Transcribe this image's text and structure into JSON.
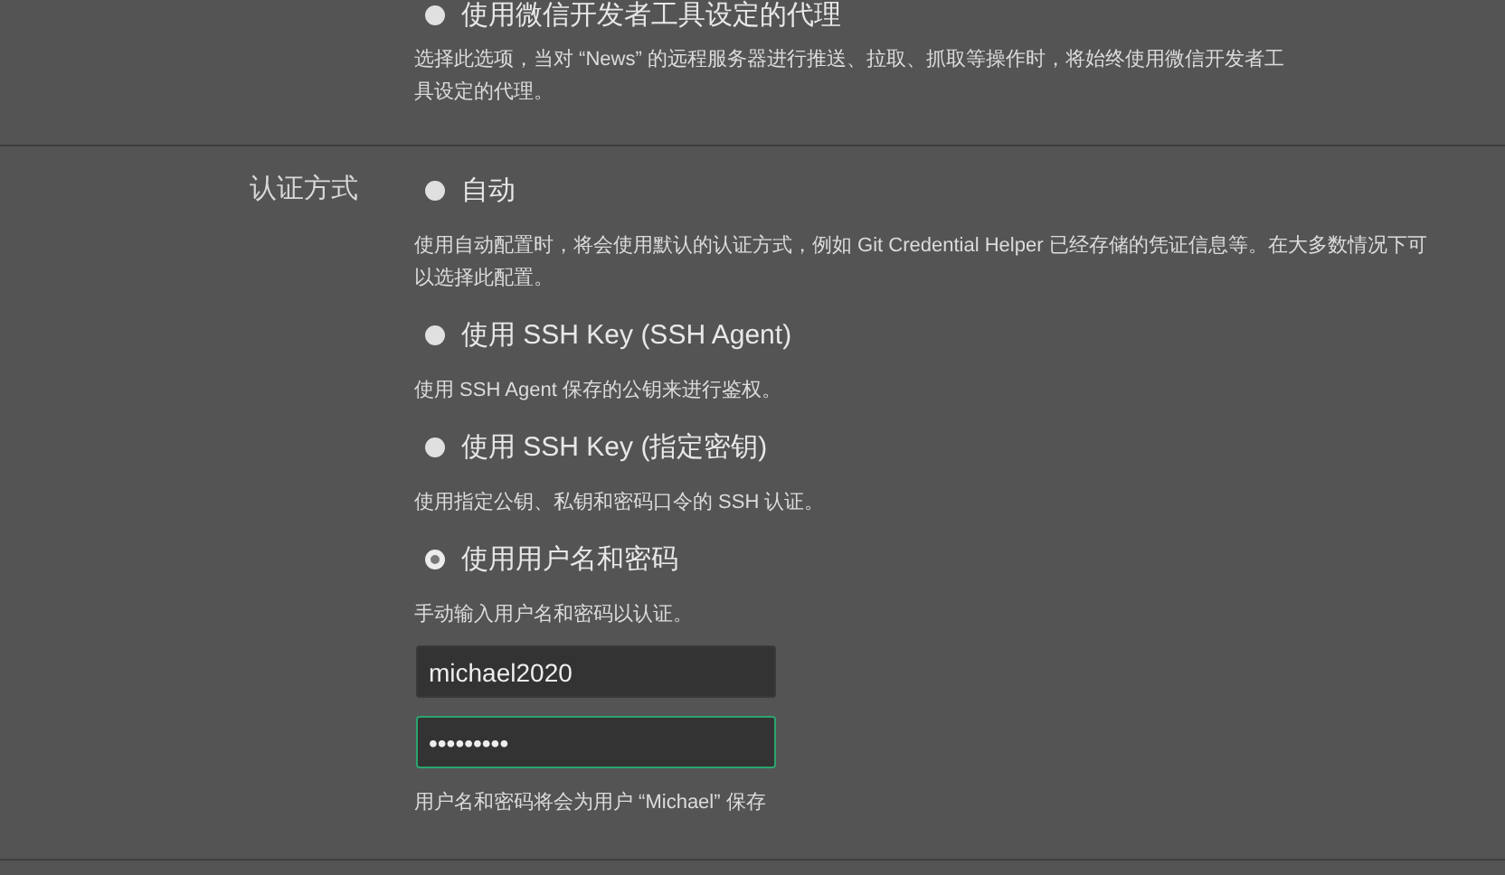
{
  "proxy_option": {
    "label": "使用微信开发者工具设定的代理",
    "selected": false,
    "description": "选择此选项，当对 “News” 的远程服务器进行推送、拉取、抓取等操作时，将始终使用微信开发者工具设定的代理。"
  },
  "auth": {
    "label": "认证方式",
    "options": [
      {
        "label": "自动",
        "selected": false,
        "description": "使用自动配置时，将会使用默认的认证方式，例如 Git Credential Helper 已经存储的凭证信息等。在大多数情况下可以选择此配置。"
      },
      {
        "label": "使用 SSH Key (SSH Agent)",
        "selected": false,
        "description": "使用 SSH Agent 保存的公钥来进行鉴权。"
      },
      {
        "label": "使用 SSH Key (指定密钥)",
        "selected": false,
        "description": "使用指定公钥、私钥和密码口令的 SSH 认证。"
      },
      {
        "label": "使用用户名和密码",
        "selected": true,
        "description": "手动输入用户名和密码以认证。"
      }
    ],
    "username_field": {
      "value": "michael2020",
      "focused": false
    },
    "password_field": {
      "value": "•••••••••",
      "focused": true
    },
    "note": "用户名和密码将会为用户 “Michael” 保存"
  }
}
